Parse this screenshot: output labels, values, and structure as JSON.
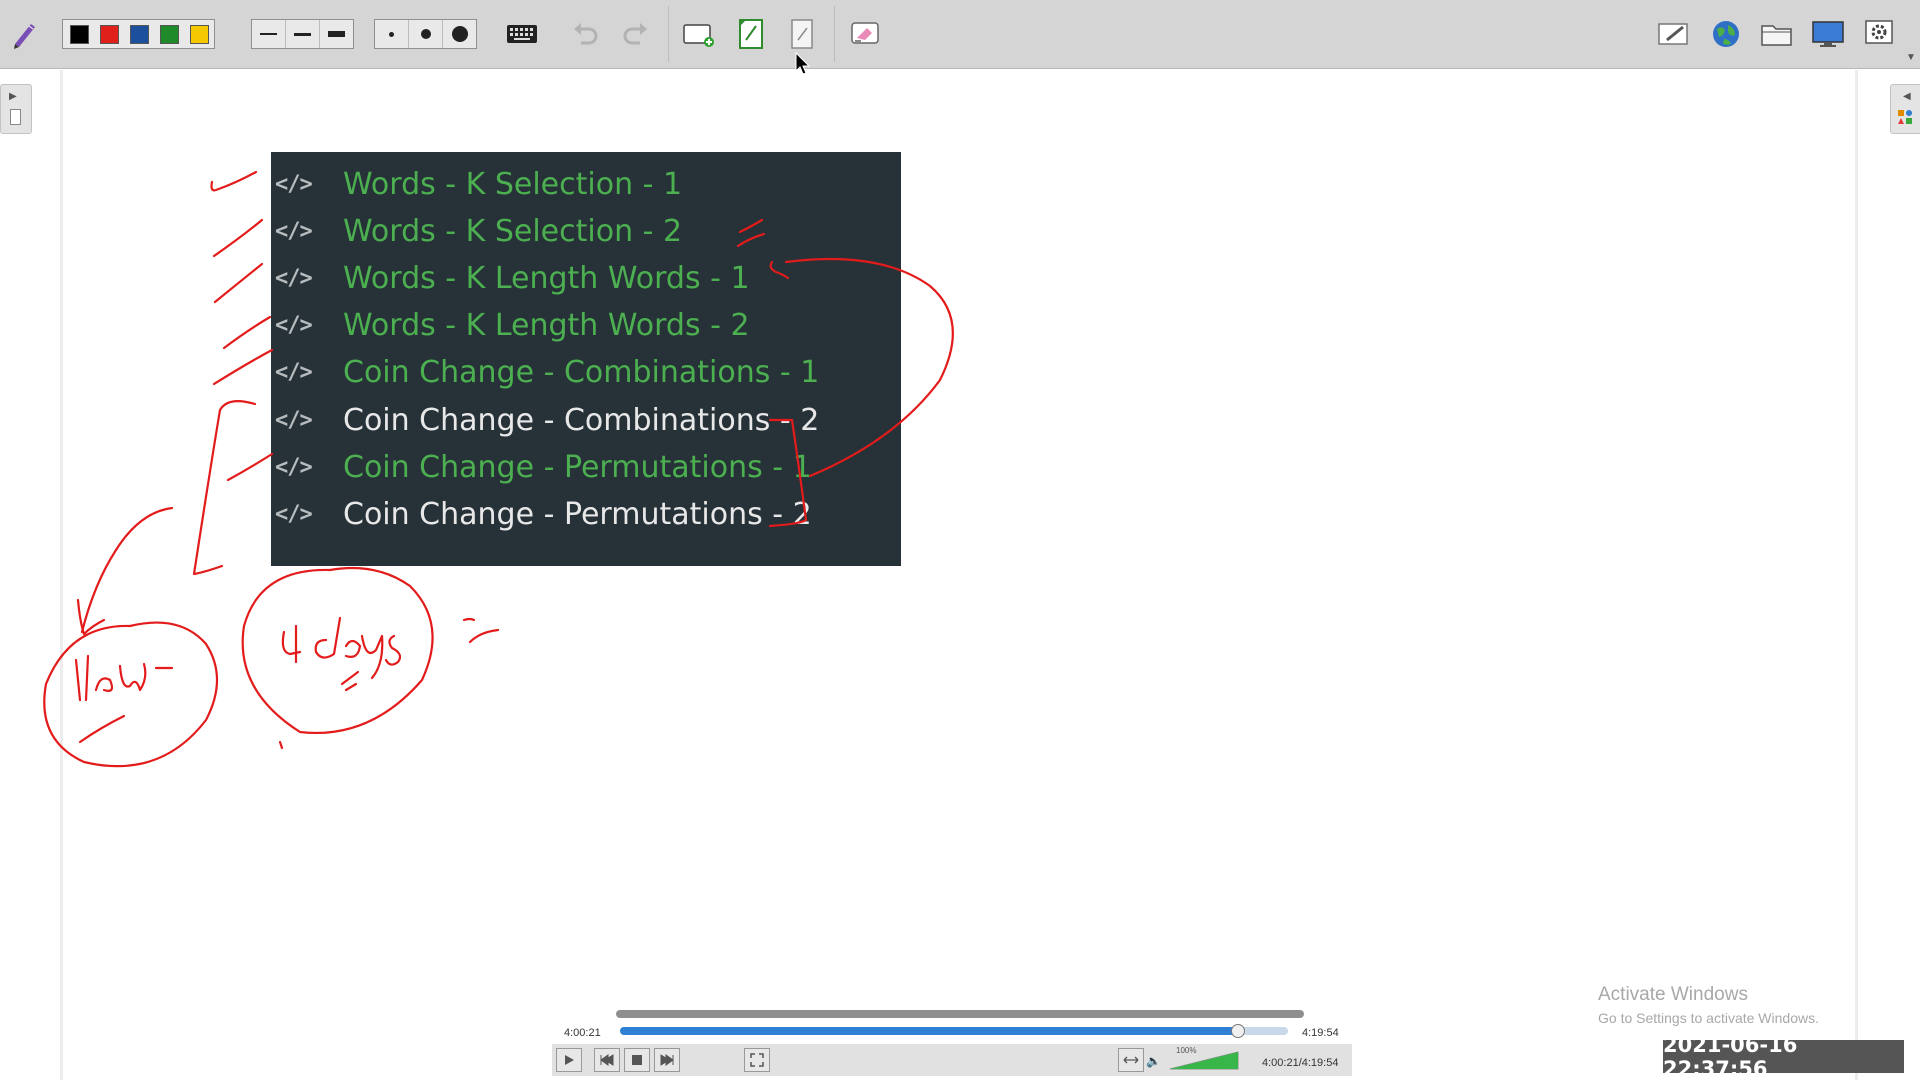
{
  "toolbar": {
    "colors": [
      "#000000",
      "#e0201b",
      "#1c4f9c",
      "#1e8a2a",
      "#f5c800"
    ],
    "icons": [
      "pen-app-icon",
      "keyboard-icon",
      "undo-icon",
      "redo-icon",
      "new-page-icon",
      "prev-page-icon",
      "next-page-icon",
      "eraser-icon",
      "whiteboard-icon",
      "web-icon",
      "folder-icon",
      "desktop-icon",
      "settings-icon"
    ]
  },
  "code_list": {
    "items": [
      {
        "icon": "</>",
        "label": "Words - K Selection - 1",
        "color": "green"
      },
      {
        "icon": "</>",
        "label": "Words - K Selection - 2",
        "color": "green"
      },
      {
        "icon": "</>",
        "label": "Words - K Length Words - 1",
        "color": "green"
      },
      {
        "icon": "</>",
        "label": "Words - K Length Words - 2",
        "color": "green"
      },
      {
        "icon": "</>",
        "label": "Coin Change - Combinations - 1",
        "color": "green"
      },
      {
        "icon": "</>",
        "label": "Coin Change - Combinations - 2",
        "color": "white"
      },
      {
        "icon": "</>",
        "label": "Coin Change - Permutations - 1",
        "color": "green"
      },
      {
        "icon": "</>",
        "label": "Coin Change - Permutations - 2",
        "color": "white"
      }
    ]
  },
  "annotations": {
    "ink_color": "#e31b1b"
  },
  "watermark": {
    "title": "Activate Windows",
    "subtitle": "Go to Settings to activate Windows."
  },
  "timestamp": "2021-06-16  22:37:56",
  "player": {
    "elapsed": "4:00:21",
    "total": "4:19:54",
    "position_label": "4:00:21/4:19:54",
    "progress": 0.924,
    "volume_label": "100%"
  }
}
